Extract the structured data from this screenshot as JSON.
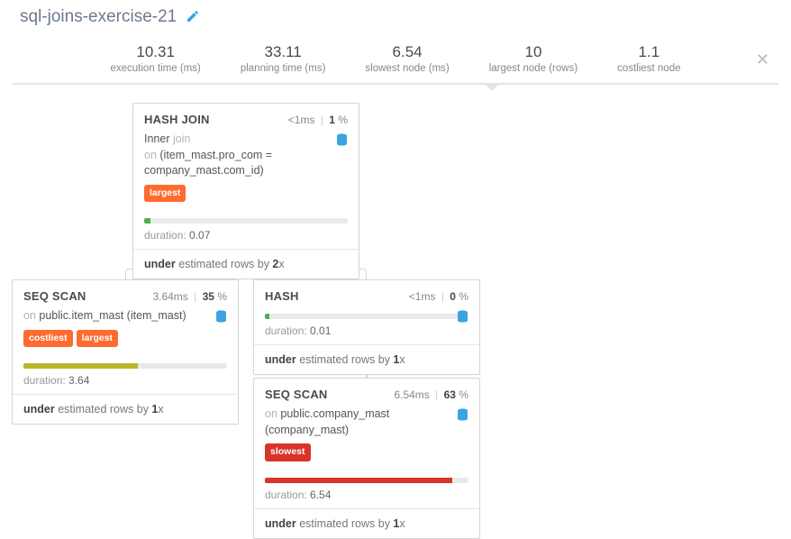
{
  "title": "sql-joins-exercise-21",
  "stats": {
    "exec": {
      "val": "10.31",
      "lbl": "execution time (ms)"
    },
    "plan": {
      "val": "33.11",
      "lbl": "planning time (ms)"
    },
    "slow": {
      "val": "6.54",
      "lbl": "slowest node (ms)"
    },
    "large": {
      "val": "10",
      "lbl": "largest node (rows)"
    },
    "cost": {
      "val": "1.1",
      "lbl": "costliest node"
    }
  },
  "nodes": {
    "hashjoin": {
      "title": "HASH JOIN",
      "dur": "<1ms",
      "pct": "1",
      "line1a": "Inner ",
      "line1b": "join",
      "line2a": "on ",
      "line2b": "(item_mast.pro_com = company_mast.com_id)",
      "badge": "largest",
      "duration": "duration: ",
      "durval": "0.07",
      "foot_a": "under",
      "foot_b": " estimated rows by ",
      "foot_c": "2",
      "foot_d": "x"
    },
    "seq1": {
      "title": "SEQ SCAN",
      "dur": "3.64ms",
      "pct": "35",
      "on_a": "on ",
      "on_b": "public.item_mast (item_mast)",
      "badge1": "costliest",
      "badge2": "largest",
      "duration": "duration: ",
      "durval": "3.64",
      "foot_a": "under",
      "foot_b": " estimated rows by ",
      "foot_c": "1",
      "foot_d": "x"
    },
    "hash": {
      "title": "HASH",
      "dur": "<1ms",
      "pct": "0",
      "duration": "duration: ",
      "durval": "0.01",
      "foot_a": "under",
      "foot_b": " estimated rows by ",
      "foot_c": "1",
      "foot_d": "x"
    },
    "seq2": {
      "title": "SEQ SCAN",
      "dur": "6.54ms",
      "pct": "63",
      "on_a": "on ",
      "on_b": "public.company_mast (company_mast)",
      "badge": "slowest",
      "duration": "duration: ",
      "durval": "6.54",
      "foot_a": "under",
      "foot_b": " estimated rows by ",
      "foot_c": "1",
      "foot_d": "x"
    }
  },
  "pct_suffix": " %"
}
